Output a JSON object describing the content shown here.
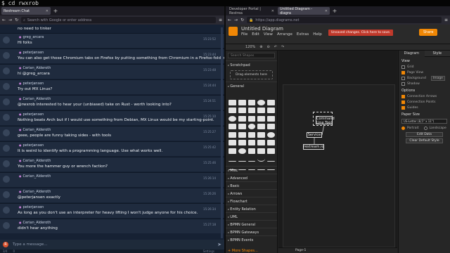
{
  "terminal": {
    "prompt": "$ cd rwxrob"
  },
  "left_browser": {
    "tab_title": "Restream Chat",
    "url_placeholder": "Search with Google or enter address",
    "messages": [
      {
        "name": "",
        "text": "no need to tinker",
        "time": ""
      },
      {
        "name": "greg_arcara",
        "text": "Hi folks",
        "time": "15:23:52"
      },
      {
        "name": "peterjansen",
        "text": "You can also get those Chromium tabs on Firefox by putting something from Chromium in a Firefox-folder.",
        "time": "15:23:44"
      },
      {
        "name": "Cerian_Alderoth",
        "text": "hi @greg_arcara",
        "time": "15:23:48"
      },
      {
        "name": "peterjansen",
        "text": "Try out MX Linux?",
        "time": "15:24:44"
      },
      {
        "name": "Cerian_Alderoth",
        "text": "@rwxrob interested to hear your (unbiased) take on Rust - worth looking into?",
        "time": "15:24:51"
      },
      {
        "name": "peterjansen",
        "text": "Nothing beats Arch but if I would use something from Debian, MX Linux would be my starting-point.",
        "time": "15:25:10"
      },
      {
        "name": "Cerian_Alderoth",
        "text": "geee, people are funny taking sides - with tools",
        "time": "15:25:27"
      },
      {
        "name": "peterjansen",
        "text": "It is weird to identify with a programming language. Use what works well.",
        "time": "15:25:42"
      },
      {
        "name": "Cerian_Alderoth",
        "text": "You more the hammer guy or wrench faction?",
        "time": "15:25:46"
      },
      {
        "name": "Cerian_Alderoth",
        "text": "",
        "time": "15:26:14"
      },
      {
        "name": "Cerian_Alderoth",
        "text": "@peterjansen exactly",
        "time": "15:26:26"
      },
      {
        "name": "peterjansen",
        "text": "As long as you don't use an interpreter for heavy lifting I won't judge anyone for his choice.",
        "time": "15:26:34"
      },
      {
        "name": "Cerian_Alderoth",
        "text": "didn't hear anything",
        "time": "15:27:18"
      }
    ],
    "composer_placeholder": "Type a message...",
    "composer_avatar": "R",
    "status": {
      "count1": "3/4",
      "count2": "0",
      "settings": "Settings"
    }
  },
  "right_browser": {
    "tabs": [
      "Developer Portal | Restrea",
      "Untitled Diagram - diagra"
    ],
    "url": "https://app.diagrams.net",
    "diagram": {
      "title": "Untitled Diagram",
      "menus": [
        "File",
        "Edit",
        "View",
        "Arrange",
        "Extras",
        "Help"
      ],
      "unsaved": "Unsaved changes. Click here to save.",
      "share": "Share",
      "zoom": "120%",
      "library": {
        "search_placeholder": "Search Shapes",
        "scratchpad": "Scratchpad",
        "drop": "Drag elements here",
        "general": "General",
        "sections": [
          "Misc",
          "Advanced",
          "Basic",
          "Arrows",
          "Flowchart",
          "Entity Relation",
          "UML",
          "BPMN General",
          "BPMN Gateways",
          "BPMN Events"
        ],
        "more": "+ More Shapes..."
      },
      "nodes": {
        "command": "Command Line Tool",
        "service": "Service",
        "restream": "restream.io"
      },
      "page_tab": "Page-1",
      "format": {
        "tabs": [
          "Diagram",
          "Style"
        ],
        "view_heading": "View",
        "grid": "Grid",
        "page_view": "Page View",
        "background": "Background",
        "image_btn": "Image",
        "shadow": "Shadow",
        "options_heading": "Options",
        "connection_arrows": "Connection Arrows",
        "connection_points": "Connection Points",
        "guides": "Guides",
        "paper_heading": "Paper Size",
        "paper_value": "US-Letter (8,5\" x 11\")",
        "portrait": "Portrait",
        "landscape": "Landscape",
        "edit_data": "Edit Data",
        "clear_style": "Clear Default Style"
      }
    }
  }
}
